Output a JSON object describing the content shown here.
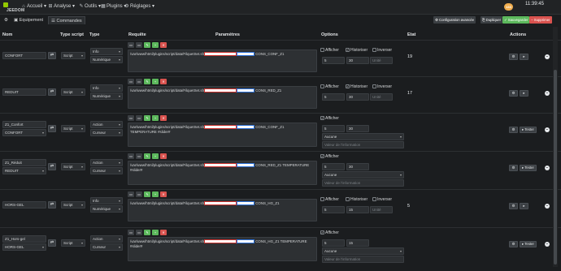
{
  "topbar": {
    "logo": "JEEDOM",
    "nav": [
      {
        "icon": "home-icon",
        "glyph": "⌂",
        "label": "Accueil ▾"
      },
      {
        "icon": "analyse-icon",
        "glyph": "⊞",
        "label": "Analyse ▾"
      },
      {
        "icon": "wrench-icon",
        "glyph": "✎",
        "label": "Outils ▾"
      },
      {
        "icon": "puzzle-icon",
        "glyph": "▦",
        "label": "Plugins ▾"
      },
      {
        "icon": "wrench2-icon",
        "glyph": "⚙",
        "label": "Réglages ▾"
      }
    ],
    "badge": "133",
    "clock": "11:39:45"
  },
  "tabs": {
    "back": "⚙",
    "equipement": "Equipement",
    "commandes": "Commandes"
  },
  "actions": {
    "config": "Configuration avancée",
    "dupliquer": "Dupliquer",
    "sauvegarder": "Sauvegarder",
    "supprimer": "Supprimer",
    "colors": {
      "config": "#3b3f43",
      "dupliquer": "#3b3f43",
      "sauvegarder": "#5cb85c",
      "supprimer": "#d9534f"
    }
  },
  "headers": {
    "nom": "Nom",
    "type_script": "Type script",
    "type": "Type",
    "requete": "Requête",
    "parametres": "Paramètres",
    "options": "Options",
    "etat": "Etat",
    "actions": "Actions"
  },
  "labels": {
    "afficher": "Afficher",
    "historiser": "Historiser",
    "inverser": "Inverser",
    "unite": "Unité",
    "tester": "Tester",
    "aucune": "Aucune",
    "valeur_info": "Valeur de l'information"
  },
  "rows": [
    {
      "name": "CONFORT",
      "script": "Script",
      "type": "Info",
      "subtype": "Numérique",
      "req": "/var/www/html/plugins/script/data/FilquetSet.sh",
      "param": "CONS_CONF_Z1",
      "param2": "",
      "min": "5",
      "max": "30",
      "etat": "19",
      "is_action": false,
      "historiser": true
    },
    {
      "name": "REDUIT",
      "script": "Script",
      "type": "Info",
      "subtype": "Numérique",
      "req": "/var/www/html/plugins/script/data/FilquetSet.sh",
      "param": "CONS_RED_Z1",
      "param2": "",
      "min": "5",
      "max": "30",
      "etat": "17",
      "is_action": false,
      "historiser": true
    },
    {
      "name": "Z1_Confort",
      "name2": "CONFORT",
      "script": "Script",
      "type": "Action",
      "subtype": "Curseur",
      "req": "/var/www/html/plugins/script/data/FilquetSet.sh",
      "param": "CONS_CONF_Z1",
      "param2": "TEMPERATURE #slider#",
      "min": "5",
      "max": "30",
      "etat": "",
      "is_action": true
    },
    {
      "name": "Z1_Réduit",
      "name2": "REDUIT",
      "script": "Script",
      "type": "Action",
      "subtype": "Curseur",
      "req": "/var/www/html/plugins/script/data/FilquetSet.sh",
      "param": "CONS_RED_Z1 TEMPERATURE",
      "param2": "#slider#",
      "min": "5",
      "max": "30",
      "etat": "",
      "is_action": true
    },
    {
      "name": "HORS-GEL",
      "script": "Script",
      "type": "Info",
      "subtype": "Numérique",
      "req": "/var/www/html/plugins/script/data/FilquetSet.sh",
      "param": "CONS_HG_Z1",
      "param2": "",
      "min": "5",
      "max": "15",
      "etat": "5",
      "is_action": false,
      "historiser": false
    },
    {
      "name": "Z1_Hors-gel",
      "name2": "HORS-GEL",
      "script": "Script",
      "type": "Action",
      "subtype": "Curseur",
      "req": "/var/www/html/plugins/script/data/FilquetSet.sh",
      "param": "CONS_HG_Z1 TEMPERATURE",
      "param2": "#slider#",
      "min": "5",
      "max": "15",
      "etat": "",
      "is_action": true
    }
  ]
}
